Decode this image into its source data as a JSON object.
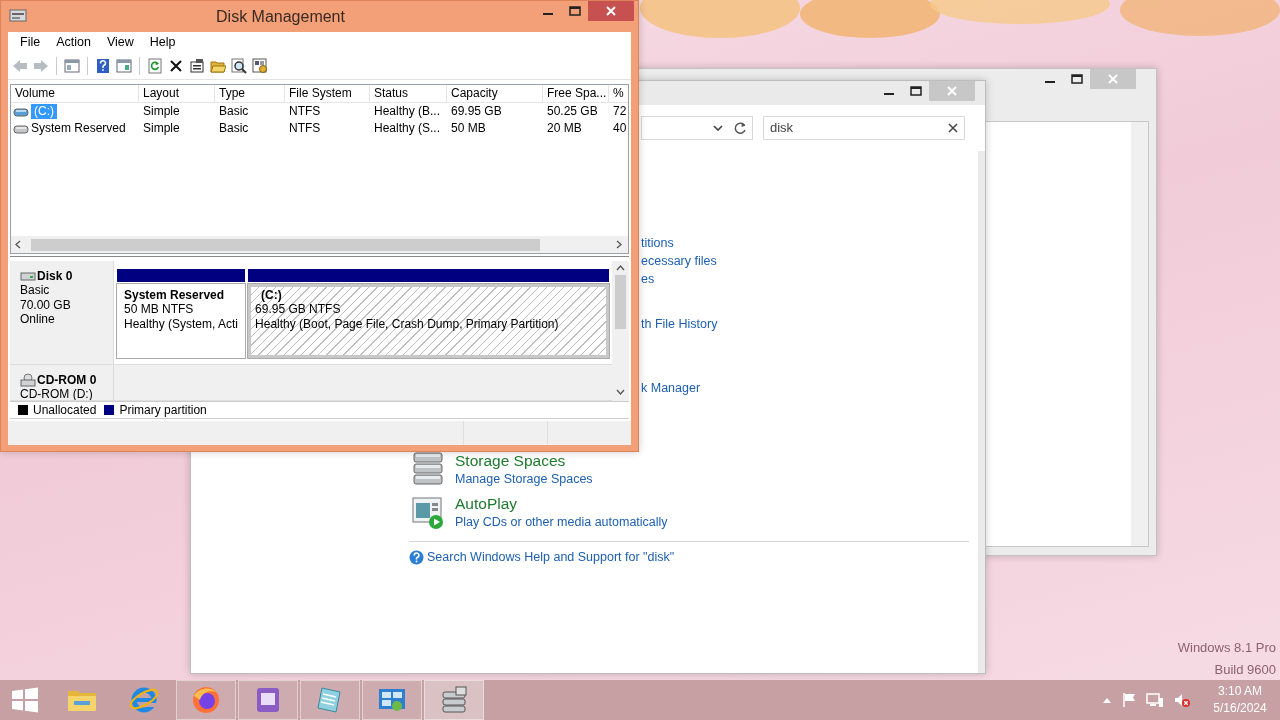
{
  "desktop": {
    "watermark": [
      "Windows 8.1 Pro",
      "Build 9600"
    ]
  },
  "control_panel": {
    "search": {
      "value": "disk"
    },
    "partial_links": [
      "titions",
      "ecessary files",
      "es",
      "th File History",
      "k Manager"
    ],
    "items": [
      {
        "kind": "storage",
        "title": "Storage Spaces",
        "link": "Manage Storage Spaces"
      },
      {
        "kind": "autoplay",
        "title": "AutoPlay",
        "link": "Play CDs or other media automatically"
      }
    ],
    "help_link": "Search Windows Help and Support for \"disk\""
  },
  "disk_management": {
    "title": "Disk Management",
    "menu": [
      "File",
      "Action",
      "View",
      "Help"
    ],
    "toolbar": [
      {
        "kind": "back",
        "disabled": true
      },
      {
        "kind": "forward",
        "disabled": true
      },
      {
        "kind": "tree",
        "disabled": false
      },
      {
        "kind": "help",
        "disabled": false
      },
      {
        "kind": "pane",
        "disabled": false
      },
      {
        "kind": "refresh",
        "disabled": false
      },
      {
        "kind": "delete",
        "disabled": false
      },
      {
        "kind": "properties",
        "disabled": false
      },
      {
        "kind": "open",
        "disabled": false
      },
      {
        "kind": "explore",
        "disabled": false
      },
      {
        "kind": "settings",
        "disabled": false
      }
    ],
    "columns": [
      "Volume",
      "Layout",
      "Type",
      "File System",
      "Status",
      "Capacity",
      "Free Spa...",
      "%"
    ],
    "rows": [
      {
        "cells": [
          "(C:)",
          "Simple",
          "Basic",
          "NTFS",
          "Healthy (B...",
          "69.95 GB",
          "50.25 GB",
          "72"
        ],
        "selected": true
      },
      {
        "cells": [
          "System Reserved",
          "Simple",
          "Basic",
          "NTFS",
          "Healthy (S...",
          "50 MB",
          "20 MB",
          "40"
        ],
        "selected": false
      }
    ],
    "disks": [
      {
        "kind": "disk",
        "name": "Disk 0",
        "lines": [
          "Basic",
          "70.00 GB",
          "Online"
        ],
        "partitions": [
          {
            "name": "System Reserved",
            "size": "50 MB NTFS",
            "status": "Healthy (System, Acti",
            "selected": false
          },
          {
            "name": "(C:)",
            "size": "69.95 GB NTFS",
            "status": "Healthy (Boot, Page File, Crash Dump, Primary Partition)",
            "selected": true
          }
        ]
      },
      {
        "kind": "cdrom",
        "name": "CD-ROM 0",
        "lines": [
          "CD-ROM (D:)"
        ]
      }
    ],
    "legend": [
      {
        "label": "Unallocated",
        "color": "#000000"
      },
      {
        "label": "Primary partition",
        "color": "#000080"
      }
    ]
  },
  "taskbar": {
    "apps": [
      {
        "kind": "start",
        "running": false,
        "selected": false
      },
      {
        "kind": "folder",
        "running": false,
        "selected": false
      },
      {
        "kind": "ie",
        "running": false,
        "selected": false
      },
      {
        "kind": "firefox",
        "running": true,
        "selected": false
      },
      {
        "kind": "purple",
        "running": true,
        "selected": false
      },
      {
        "kind": "notepad",
        "running": true,
        "selected": false
      },
      {
        "kind": "control",
        "running": true,
        "selected": false
      },
      {
        "kind": "disk",
        "running": true,
        "selected": true
      }
    ],
    "tray": [
      {
        "kind": "chevron"
      },
      {
        "kind": "flag"
      },
      {
        "kind": "network"
      },
      {
        "kind": "volume",
        "muted": true
      }
    ],
    "time": "3:10 AM",
    "date": "5/16/2024"
  }
}
